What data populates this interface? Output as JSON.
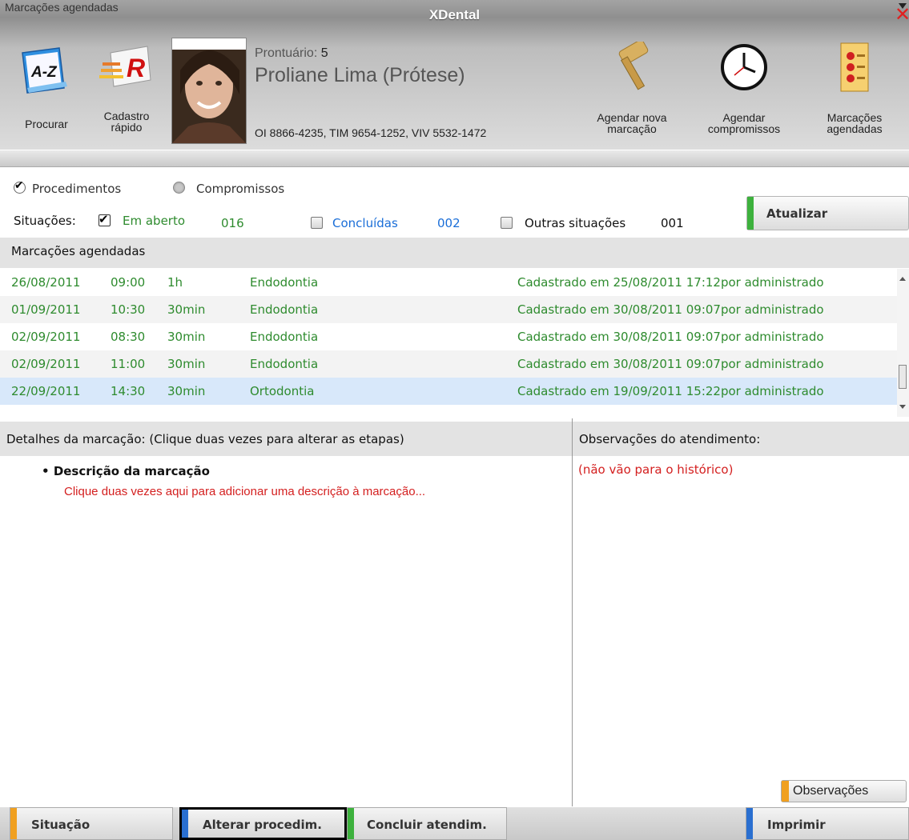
{
  "window": {
    "title": "XDental"
  },
  "toolbar": {
    "search_label": "Procurar",
    "quick_register_line1": "Cadastro",
    "quick_register_line2": "rápido",
    "new_appointment_line1": "Agendar nova",
    "new_appointment_line2": "marcação",
    "schedule_commitments_line1": "Agendar",
    "schedule_commitments_line2": "compromissos",
    "scheduled_line1": "Marcações",
    "scheduled_line2": "agendadas",
    "az_icon_text": "A-Z",
    "r_icon_text": "R"
  },
  "patient": {
    "record_label": "Prontuário:",
    "record_number": "5",
    "name": "Proliane Lima (Prótese)",
    "phones": "OI 8866-4235, TIM 9654-1252, VIV 5532-1472"
  },
  "section_bar": {
    "label": "Marcações agendadas"
  },
  "filters": {
    "procedures_label": "Procedimentos",
    "procedures_selected": true,
    "commitments_label": "Compromissos",
    "situations_label": "Situações:",
    "open_label": "Em aberto",
    "open_count": "016",
    "open_checked": true,
    "completed_label": "Concluídas",
    "completed_count": "002",
    "completed_checked": false,
    "other_label": "Outras situações",
    "other_count": "001",
    "other_checked": false
  },
  "refresh_button": {
    "label": "Atualizar"
  },
  "appointments": {
    "header": "Marcações agendadas",
    "rows": [
      {
        "date": "26/08/2011",
        "time": "09:00",
        "duration": "1h",
        "procedure": "Endodontia",
        "info": "Cadastrado em 25/08/2011 17:12por administrado"
      },
      {
        "date": "01/09/2011",
        "time": "10:30",
        "duration": "30min",
        "procedure": "Endodontia",
        "info": "Cadastrado em 30/08/2011 09:07por administrado"
      },
      {
        "date": "02/09/2011",
        "time": "08:30",
        "duration": "30min",
        "procedure": "Endodontia",
        "info": "Cadastrado em 30/08/2011 09:07por administrado"
      },
      {
        "date": "02/09/2011",
        "time": "11:00",
        "duration": "30min",
        "procedure": "Endodontia",
        "info": "Cadastrado em 30/08/2011 09:07por administrado"
      },
      {
        "date": "22/09/2011",
        "time": "14:30",
        "duration": "30min",
        "procedure": "Ortodontia",
        "info": "Cadastrado em 19/09/2011 15:22por administrado"
      }
    ]
  },
  "details": {
    "header": "Detalhes da marcação: (Clique duas vezes para alterar as etapas)",
    "bullet_title": "Descrição da marcação",
    "hint": "Clique duas vezes aqui para adicionar uma descrição à marcação..."
  },
  "observations": {
    "header": "Observações do atendimento:",
    "note": "(não vão para o histórico)",
    "button_label": "Observações"
  },
  "bottom_buttons": {
    "status": "Situação",
    "change_procedure": "Alterar procedim.",
    "finish": "Concluir atendim.",
    "print": "Imprimir"
  },
  "colors": {
    "green_text": "#2e8b2e",
    "blue_text": "#1a6ed8",
    "red_text": "#d42020",
    "selected_row": "#d8e8fa"
  }
}
